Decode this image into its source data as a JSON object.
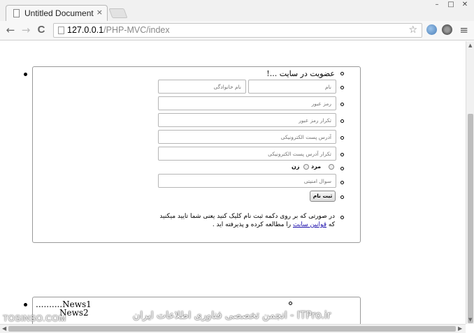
{
  "browser": {
    "tab_title": "Untitled Document",
    "tab_close": "×",
    "url_host": "127.0.0.1",
    "url_path": "/PHP-MVC/index",
    "back": "←",
    "forward": "→",
    "reload": "C",
    "star": "☆",
    "menu": "≡",
    "win_min": "–",
    "win_max": "□",
    "win_close": "✕"
  },
  "form": {
    "title": "عضویت در سایت ...!",
    "first_name_placeholder": "نام",
    "last_name_placeholder": "نام خانوادگی",
    "password_placeholder": "رمز عبور",
    "password_confirm_placeholder": "تکرار رمز عبور",
    "email_placeholder": "آدرس پست الکترونیکی",
    "email_confirm_placeholder": "تکرار آدرس پست الکترونیکی",
    "gender_male": "مرد",
    "gender_female": "زن",
    "security_question_placeholder": "سوال امنیتی",
    "submit_label": "ثبت نام",
    "terms_line1": "در صورتی که بر روی دکمه ثبت نام کلیک کنید یعنی شما تایید میکنید",
    "terms_prefix": "که ",
    "terms_link": "قوانین سایت",
    "terms_suffix": " را مطالعه کرده و پذیرفته اید ."
  },
  "news": {
    "item1": "..........News1",
    "item2": "News2"
  },
  "watermark": {
    "left": "TOSINSO.COM",
    "right": "ITPro.ir - انجمن تخصصی فناوری اطلاعات ایران"
  },
  "colors": {
    "link": "#1a0dab",
    "ext_globe": "#4a7fb8",
    "ext_gear": "#555555"
  }
}
